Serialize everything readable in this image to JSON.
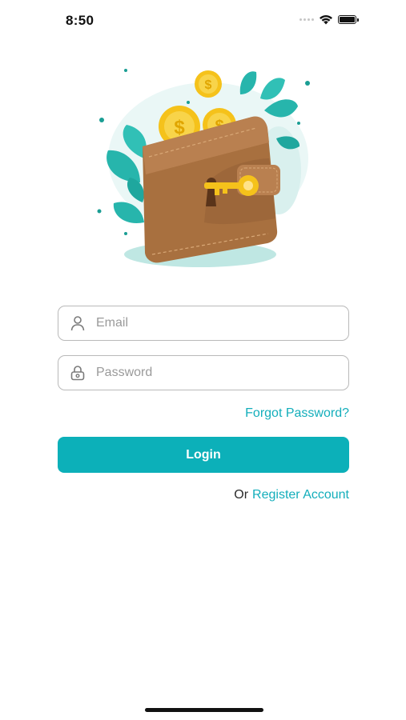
{
  "status_bar": {
    "time": "8:50",
    "icons": [
      "signal-dots-icon",
      "wifi-icon",
      "battery-icon"
    ]
  },
  "illustration": {
    "name": "wallet-with-key-and-coins",
    "colors": {
      "wallet": "#a8703f",
      "wallet_dark": "#8c5a2f",
      "coin": "#f5c21b",
      "leaf": "#27b5ac",
      "leaf_light": "#c9ecea"
    }
  },
  "form": {
    "email_placeholder": "Email",
    "email_value": "",
    "email_icon": "user-icon",
    "password_placeholder": "Password",
    "password_value": "",
    "password_icon": "lock-icon",
    "forgot_label": "Forgot Password?",
    "login_label": "Login",
    "or_label": "Or",
    "register_label": "Register Account"
  },
  "colors": {
    "accent": "#0cb0b9",
    "link": "#13aebb",
    "border": "#b9b9b9",
    "placeholder": "#9a9a9a"
  }
}
